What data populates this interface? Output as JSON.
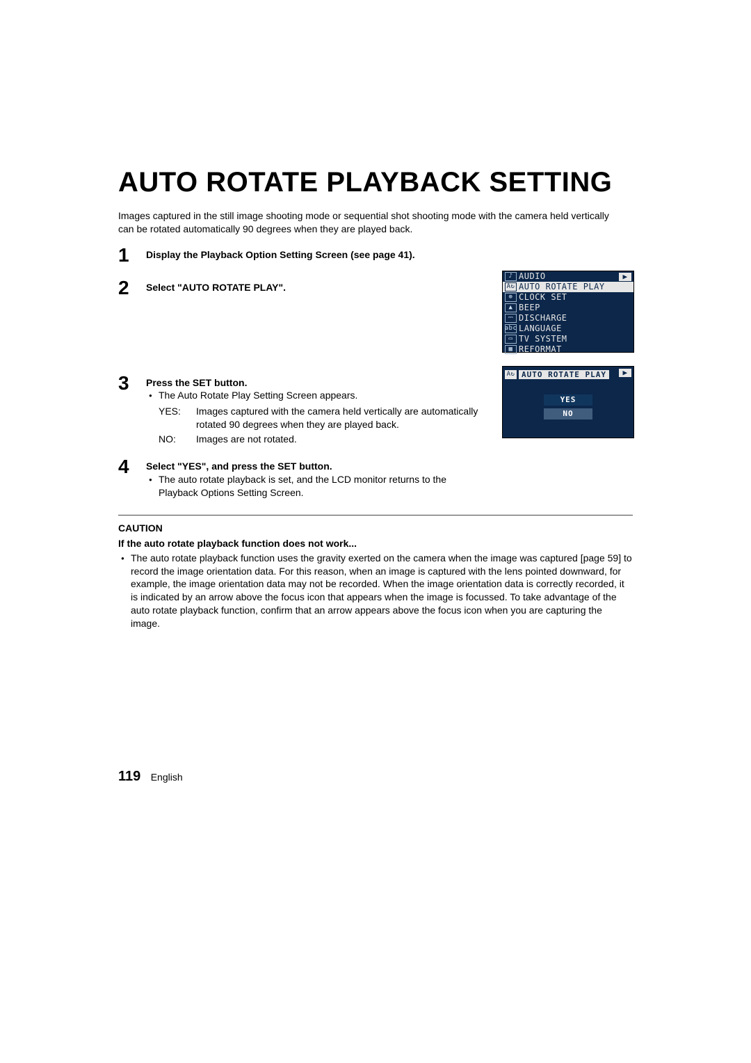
{
  "title": "AUTO ROTATE PLAYBACK SETTING",
  "intro": "Images captured in the still image shooting mode or sequential shot shooting mode with the camera held vertically can be rotated automatically 90 degrees when they are played back.",
  "steps": {
    "s1": {
      "num": "1",
      "head": "Display the Playback Option Setting Screen (see page 41)."
    },
    "s2": {
      "num": "2",
      "head": "Select \"AUTO ROTATE PLAY\"."
    },
    "s3": {
      "num": "3",
      "head": "Press the SET button.",
      "bullet": "The Auto Rotate Play Setting Screen appears.",
      "defs": {
        "yes_term": "YES:",
        "yes_body": "Images captured with the camera held vertically are automatically rotated 90 degrees when they are played back.",
        "no_term": "NO:",
        "no_body": "Images are not rotated."
      }
    },
    "s4": {
      "num": "4",
      "head": "Select \"YES\", and press the SET button.",
      "bullet": "The auto rotate playback is set, and the LCD monitor returns to the Playback Options Setting Screen."
    }
  },
  "caution": {
    "label": "CAUTION",
    "subhead": "If the auto rotate playback function does not work...",
    "body": "The auto rotate playback function uses the gravity exerted on the camera when the image was captured [page 59] to record the image orientation data. For this reason, when an image is captured with the lens pointed downward, for example, the image orientation data may not be recorded. When the image orientation data is correctly recorded, it is indicated by an arrow above the focus icon that appears when the image is focussed. To take advantage of the auto rotate playback function, confirm that an arrow appears above the focus icon when you are capturing the image."
  },
  "footer": {
    "page": "119",
    "lang": "English"
  },
  "lcd1": {
    "mode_icon": "▶",
    "items": [
      {
        "icon": "♪",
        "label": "AUDIO"
      },
      {
        "icon": "A↻",
        "label": "AUTO ROTATE PLAY",
        "selected": true
      },
      {
        "icon": "⊕",
        "label": "CLOCK SET"
      },
      {
        "icon": "▲",
        "label": "BEEP"
      },
      {
        "icon": "⎓",
        "label": "DISCHARGE"
      },
      {
        "icon": "abc",
        "label": "LANGUAGE"
      },
      {
        "icon": "▭",
        "label": "TV SYSTEM"
      },
      {
        "icon": "▦",
        "label": "REFORMAT"
      }
    ]
  },
  "lcd2": {
    "mode_icon": "▶",
    "header_icon": "A↻",
    "header_text": "AUTO ROTATE PLAY",
    "yes": "YES",
    "no": "NO"
  }
}
